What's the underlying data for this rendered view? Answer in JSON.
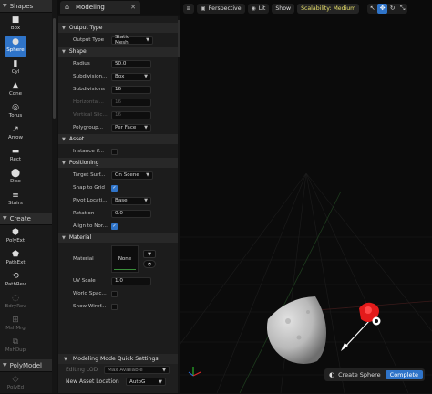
{
  "palette": {
    "shapes_header": "Shapes",
    "shapes": [
      {
        "label": "Box",
        "icon": "box-icon",
        "active": false
      },
      {
        "label": "Sphere",
        "icon": "sphere-icon",
        "active": true
      },
      {
        "label": "Cyl",
        "icon": "cylinder-icon",
        "active": false
      },
      {
        "label": "Cone",
        "icon": "cone-icon",
        "active": false
      },
      {
        "label": "Torus",
        "icon": "torus-icon",
        "active": false
      },
      {
        "label": "Arrow",
        "icon": "arrow-icon",
        "active": false
      },
      {
        "label": "Rect",
        "icon": "rect-icon",
        "active": false
      },
      {
        "label": "Disc",
        "icon": "disc-icon",
        "active": false
      },
      {
        "label": "Stairs",
        "icon": "stairs-icon",
        "active": false
      }
    ],
    "create_header": "Create",
    "create": [
      {
        "label": "PolyExt",
        "icon": "polyext-icon",
        "dim": false
      },
      {
        "label": "PathExt",
        "icon": "pathext-icon",
        "dim": false
      },
      {
        "label": "PathRev",
        "icon": "pathrev-icon",
        "dim": false
      },
      {
        "label": "BdryRev",
        "icon": "bdryrev-icon",
        "dim": true
      },
      {
        "label": "MshMrg",
        "icon": "meshmerge-icon",
        "dim": true
      },
      {
        "label": "MshDup",
        "icon": "meshdup-icon",
        "dim": true
      }
    ],
    "polymodel_header": "PolyModel",
    "polymodel": [
      {
        "label": "PolyEd",
        "icon": "polyedit-icon",
        "dim": true
      }
    ]
  },
  "tab": {
    "title": "Modeling"
  },
  "details": {
    "output_type_header": "Output Type",
    "output_type_label": "Output Type",
    "output_type_value": "Static Mesh",
    "shape_header": "Shape",
    "radius_label": "Radius",
    "radius_value": "50.0",
    "subdivision_type_label": "Subdivision...",
    "subdivision_type_value": "Box",
    "subdivisions_label": "Subdivisions",
    "subdivisions_value": "16",
    "horizontal_label": "Horizontal...",
    "horizontal_value": "16",
    "vertical_label": "Vertical Slic...",
    "vertical_value": "16",
    "polygroup_label": "Polygroup...",
    "polygroup_value": "Per Face",
    "asset_header": "Asset",
    "instance_label": "Instance if...",
    "positioning_header": "Positioning",
    "target_surface_label": "Target Surf...",
    "target_surface_value": "On Scene",
    "snap_label": "Snap to Grid",
    "pivot_label": "Pivot Locati...",
    "pivot_value": "Base",
    "rotation_label": "Rotation",
    "rotation_value": "0.0",
    "align_label": "Align to Nor...",
    "material_header": "Material",
    "material_label": "Material",
    "material_value": "None",
    "uv_scale_label": "UV Scale",
    "uv_scale_value": "1.0",
    "world_space_label": "World Spac...",
    "show_wire_label": "Show Wiref..."
  },
  "quick_settings": {
    "header": "Modeling Mode Quick Settings",
    "editing_lod_label": "Editing LOD",
    "editing_lod_value": "Max Available",
    "new_asset_label": "New Asset Location",
    "new_asset_value": "AutoG"
  },
  "viewport": {
    "perspective_label": "Perspective",
    "lit_label": "Lit",
    "show_label": "Show",
    "scalability_label": "Scalability: Medium",
    "accent_color": "#2f74c9",
    "scalability_color": "#e8e069"
  },
  "accept": {
    "label": "Create Sphere",
    "button": "Complete"
  }
}
